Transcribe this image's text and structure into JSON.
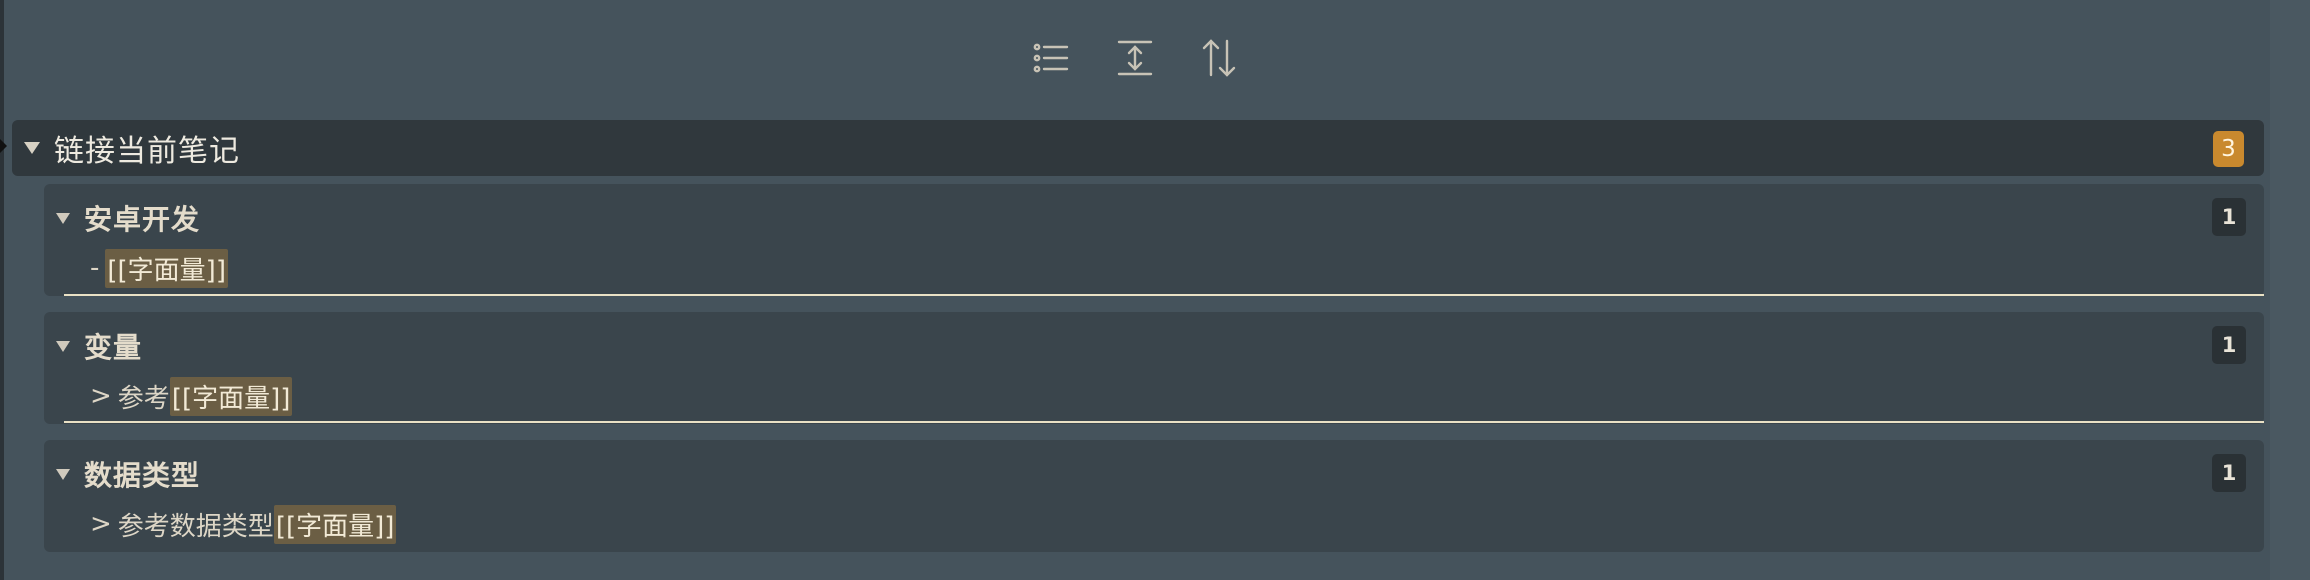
{
  "toolbar": {
    "icons": [
      "list-icon",
      "expand-vertical-icon",
      "sort-icon"
    ]
  },
  "group": {
    "title": "链接当前笔记",
    "count": "3"
  },
  "results": [
    {
      "title": "安卓开发",
      "count": "1",
      "prefix": "-",
      "before": "",
      "match": "[[字面量]]"
    },
    {
      "title": "变量",
      "count": "1",
      "prefix": ">",
      "before": "参考",
      "match": "[[字面量]]"
    },
    {
      "title": "数据类型",
      "count": "1",
      "prefix": ">",
      "before": "参考数据类型",
      "match": "[[字面量]]"
    }
  ],
  "colors": {
    "background": "#45535c",
    "header": "#30383d",
    "card": "#3a454c",
    "accent_badge": "#c9892e",
    "highlight": "#6b5e44"
  }
}
